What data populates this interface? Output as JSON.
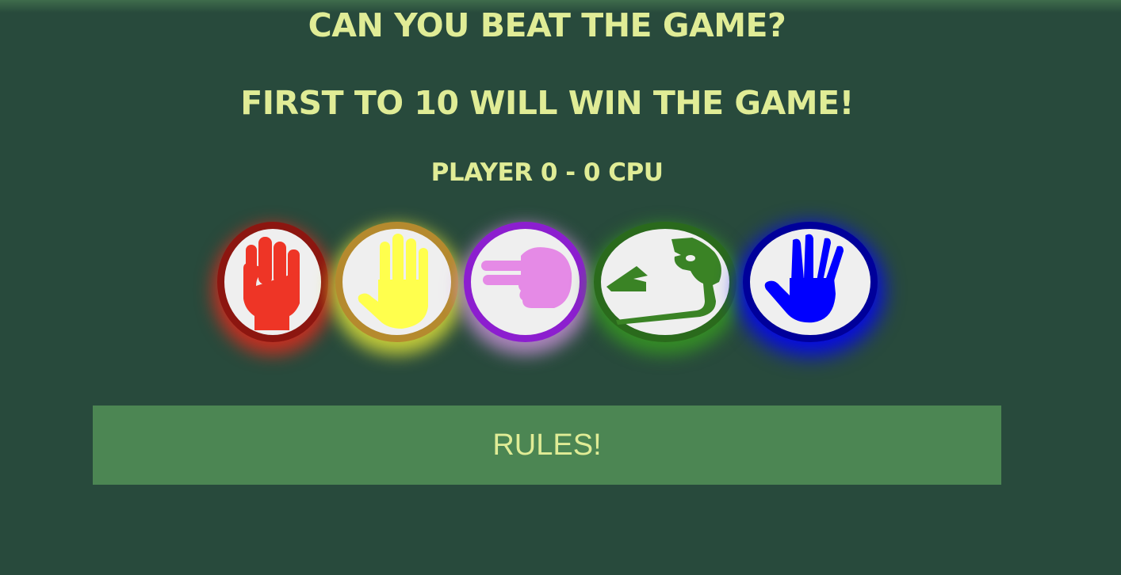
{
  "heading": {
    "title": "CAN YOU BEAT THE GAME?",
    "subtitle": "FIRST TO 10 WILL WIN THE GAME!"
  },
  "score": {
    "text": "PLAYER 0 - 0 CPU",
    "player": 0,
    "cpu": 0
  },
  "choices": [
    {
      "name": "rock",
      "icon": "fist-icon",
      "color": "#ee3526",
      "ring": "#8c1610",
      "glow": "#e8291c"
    },
    {
      "name": "paper",
      "icon": "open-hand-icon",
      "color": "#ffff4d",
      "ring": "#b58a2e",
      "glow": "#f6f63a"
    },
    {
      "name": "scissors",
      "icon": "two-finger-hand-icon",
      "color": "#e58ae6",
      "ring": "#8c1ecf",
      "glow": "#d99ae8"
    },
    {
      "name": "lizard",
      "icon": "lizard-icon",
      "color": "#3a8325",
      "ring": "#2a6a1c",
      "glow": "#39a31f"
    },
    {
      "name": "spock",
      "icon": "vulcan-salute-icon",
      "color": "#0000ff",
      "ring": "#00009a",
      "glow": "#0000ff"
    }
  ],
  "rules_button": {
    "label": "RULES!"
  }
}
